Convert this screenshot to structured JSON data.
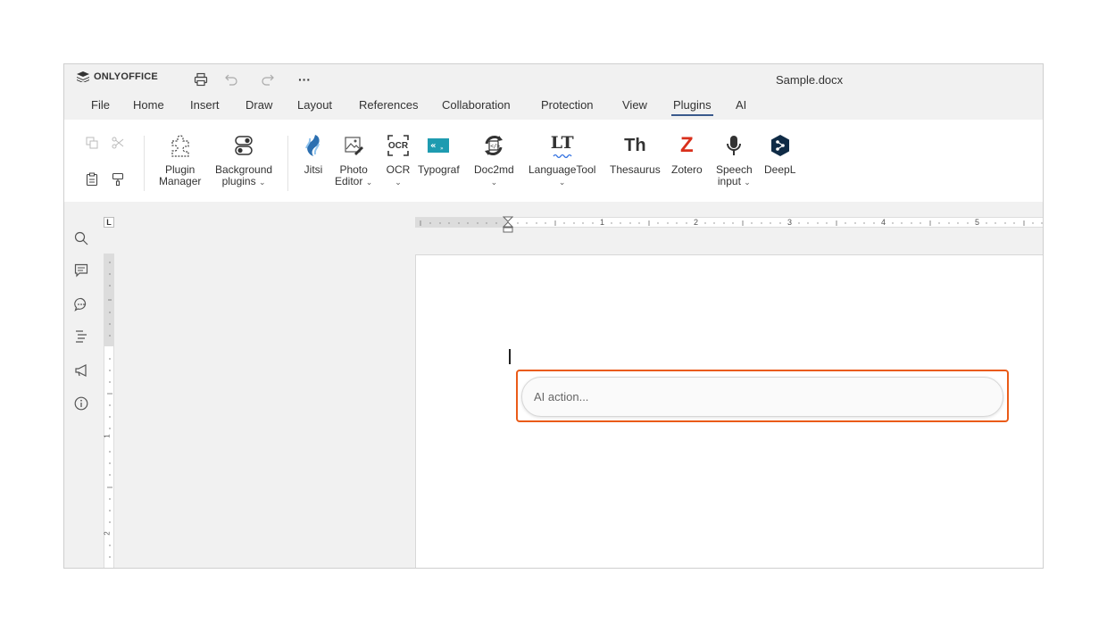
{
  "app": {
    "brand": "ONLYOFFICE",
    "document_title": "Sample.docx"
  },
  "quick_access": [
    {
      "name": "print-icon"
    },
    {
      "name": "undo-icon"
    },
    {
      "name": "redo-icon"
    },
    {
      "name": "more-icon",
      "glyph": "···"
    }
  ],
  "menu": {
    "tabs": [
      {
        "label": "File"
      },
      {
        "label": "Home"
      },
      {
        "label": "Insert"
      },
      {
        "label": "Draw"
      },
      {
        "label": "Layout"
      },
      {
        "label": "References"
      },
      {
        "label": "Collaboration"
      },
      {
        "label": "Protection"
      },
      {
        "label": "View"
      },
      {
        "label": "Plugins",
        "active": true
      },
      {
        "label": "AI"
      }
    ]
  },
  "toolbar": {
    "buttons": [
      {
        "label": "Plugin\nManager",
        "icon": "puzzle-icon"
      },
      {
        "label": "Background\nplugins",
        "icon": "toggles-icon",
        "dropdown": true
      },
      {
        "label": "Jitsi",
        "icon": "jitsi-icon"
      },
      {
        "label": "Photo\nEditor",
        "icon": "photo-editor-icon",
        "dropdown": true
      },
      {
        "label": "OCR",
        "icon": "ocr-icon",
        "dropdown": true
      },
      {
        "label": "Typograf",
        "icon": "typograf-icon"
      },
      {
        "label": "Doc2md",
        "icon": "doc2md-icon",
        "dropdown": true
      },
      {
        "label": "LanguageTool",
        "icon": "languagetool-icon",
        "dropdown": true
      },
      {
        "label": "Thesaurus",
        "icon": "thesaurus-icon"
      },
      {
        "label": "Zotero",
        "icon": "zotero-icon"
      },
      {
        "label": "Speech\ninput",
        "icon": "microphone-icon",
        "dropdown": true
      },
      {
        "label": "DeepL",
        "icon": "deepl-icon"
      }
    ],
    "icon_text": {
      "ocr": "OCR",
      "languagetool": "LT",
      "thesaurus": "Th",
      "zotero": "Z"
    }
  },
  "sidebar": {
    "icons": [
      "search-icon",
      "comments-icon",
      "chat-icon",
      "navigation-icon",
      "feedback-icon",
      "about-icon"
    ]
  },
  "ruler": {
    "corner": "L",
    "h_numbers": [
      "1",
      "2",
      "3",
      "4",
      "5"
    ],
    "v_numbers": [
      "1",
      "2"
    ]
  },
  "editor": {
    "ai_placeholder": "AI action..."
  },
  "colors": {
    "accent_tab_underline": "#3a5a8c",
    "ai_highlight": "#ea5b18",
    "zotero_red": "#d9301c",
    "typograf_teal": "#1e9bb0",
    "deepl_navy": "#0f2b46"
  }
}
